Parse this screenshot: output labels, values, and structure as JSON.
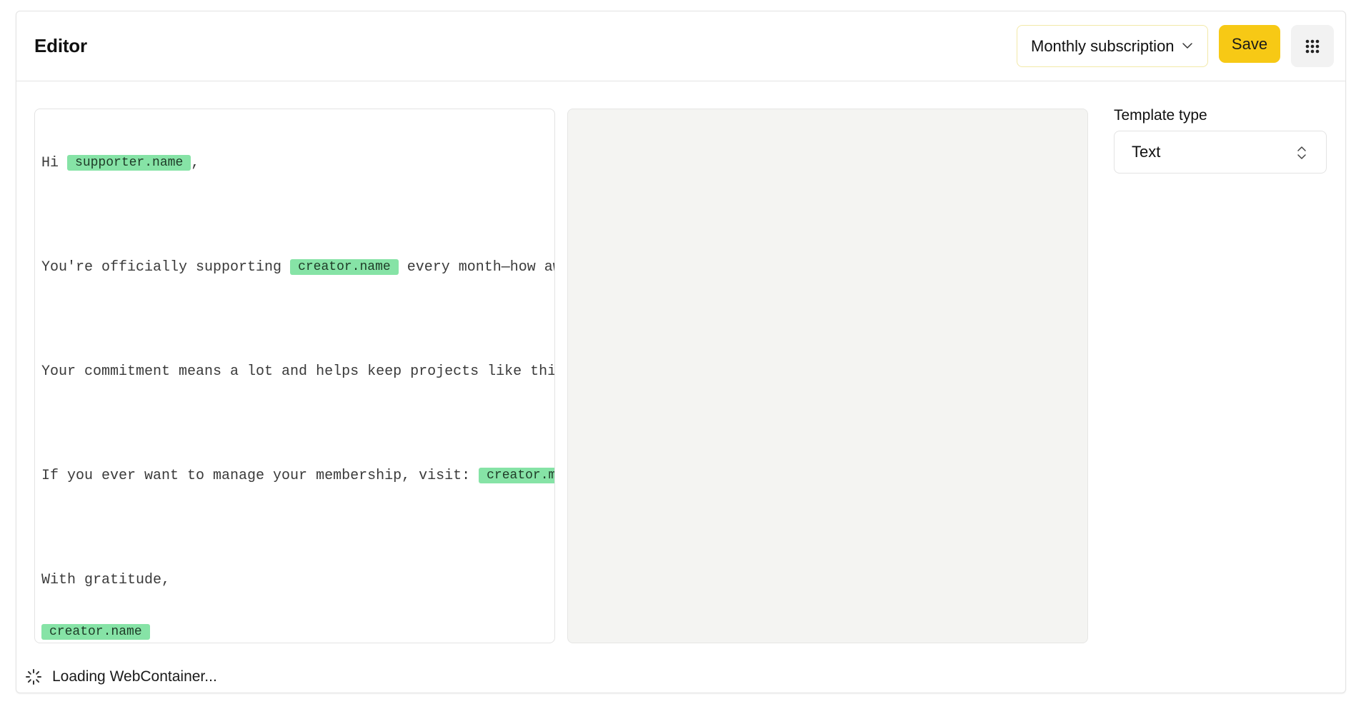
{
  "header": {
    "title": "Editor",
    "subscription_select": {
      "selected": "Monthly subscription",
      "icon": "chevron-down-icon"
    },
    "save_label": "Save",
    "menu_icon": "grid-dots-icon",
    "accent_color": "#f7c915"
  },
  "editor": {
    "token_color": "#86e3a6",
    "lines": [
      {
        "text": "Hi ",
        "token": "supporter.name",
        "after": ","
      },
      {
        "text": "You're officially supporting ",
        "token": "creator.name",
        "after": " every month—how awe"
      },
      {
        "text": "Your commitment means a lot and helps keep projects like this"
      },
      {
        "text": "If you ever want to manage your membership, visit: ",
        "token": "creator.me"
      },
      {
        "text": "With gratitude,"
      },
      {
        "token": "creator.name"
      }
    ]
  },
  "sidebar": {
    "template_type_label": "Template type",
    "template_type_selected": "Text",
    "template_type_icon": "chevrons-up-down-icon"
  },
  "status": {
    "text": "Loading WebContainer...",
    "icon": "spinner-icon"
  }
}
